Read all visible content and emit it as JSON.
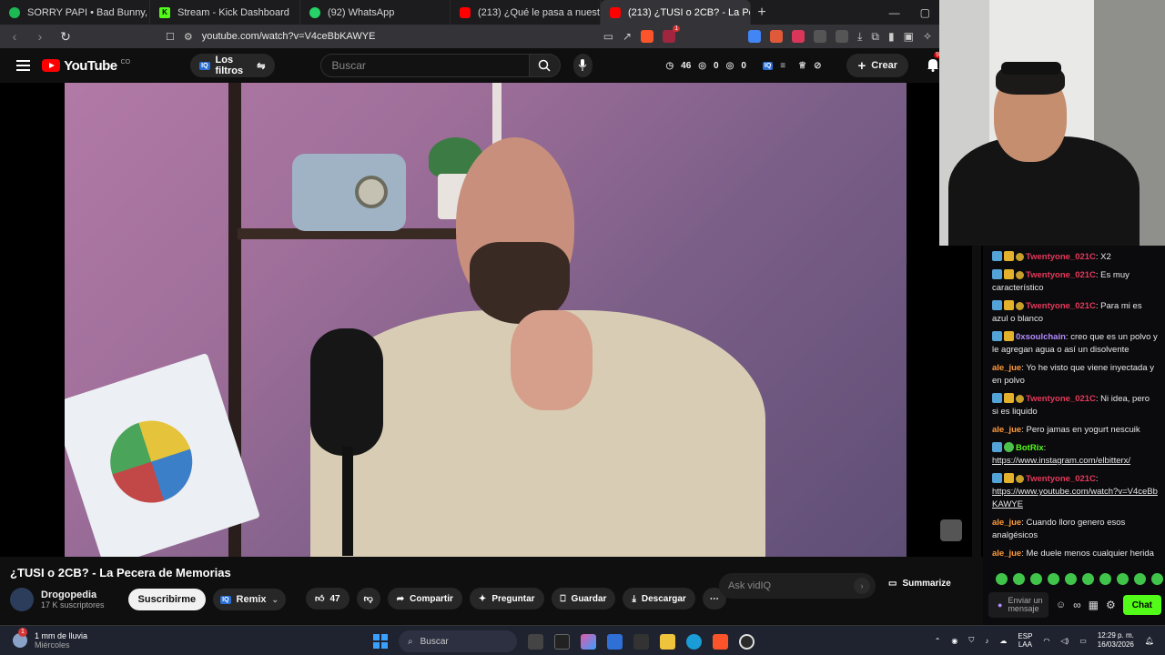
{
  "browser": {
    "tabs": [
      {
        "title": "SORRY PAPI • Bad Bunny, ABRA",
        "color": "#1db954",
        "active": false
      },
      {
        "title": "Stream - Kick Dashboard",
        "color": "#53fc18",
        "active": false
      },
      {
        "title": "(92) WhatsApp",
        "color": "#25d366",
        "active": false
      },
      {
        "title": "(213) ¿Qué le pasa a nuestro cuerpo",
        "color": "#ff0000",
        "active": false
      },
      {
        "title": "(213) ¿TUSI o 2CB? - La Pecera d",
        "color": "#ff0000",
        "active": true
      }
    ],
    "url": "youtube.com/watch?v=V4ceBbKAWYE",
    "shield_badge": "1"
  },
  "youtube": {
    "logo_text": "YouTube",
    "country_code": "CO",
    "filters_label": "Los filtros",
    "search_placeholder": "Buscar",
    "counts": {
      "a": "46",
      "b": "0",
      "c": "0"
    },
    "create_label": "Crear",
    "notif_badge": "9+"
  },
  "video": {
    "title": "¿TUSI o 2CB? - La Pecera de Memorias",
    "channel_name": "Drogopedia",
    "subscribers": "17 K suscriptores",
    "subscribe_label": "Suscribirme",
    "remix_label": "Remix",
    "likes": "47",
    "share_label": "Compartir",
    "ask_label": "Preguntar",
    "save_label": "Guardar",
    "download_label": "Descargar",
    "ask_placeholder": "Ask vidIQ",
    "summarize_label": "Summarize"
  },
  "chat": {
    "messages": [
      {
        "user": "Twentyone_021C",
        "color": "red",
        "badges": 3,
        "text": ": X2"
      },
      {
        "user": "Twentyone_021C",
        "color": "red",
        "badges": 3,
        "text": ": Es muy característico"
      },
      {
        "user": "Twentyone_021C",
        "color": "red",
        "badges": 3,
        "text": ": Para mi es azul o blanco"
      },
      {
        "user": "0xsoulchain",
        "color": "purple",
        "badges": 2,
        "text": ": creo que es un polvo y le agregan agua o así un disolvente"
      },
      {
        "user": "ale_jue",
        "color": "orange",
        "badges": 0,
        "text": ": Yo he visto que viene inyectada y en polvo"
      },
      {
        "user": "Twentyone_021C",
        "color": "red",
        "badges": 3,
        "text": ": Ni idea, pero si es liquido"
      },
      {
        "user": "ale_jue",
        "color": "orange",
        "badges": 0,
        "text": ": Pero jamas en yogurt nescuik"
      },
      {
        "user": "BotRix",
        "color": "green",
        "badges": 4,
        "text": ":",
        "link": "https://www.instagram.com/elbitterx/"
      },
      {
        "user": "Twentyone_021C",
        "color": "red",
        "badges": 3,
        "text": ":",
        "link": "https://www.youtube.com/watch?v=V4ceBbKAWYE"
      },
      {
        "user": "ale_jue",
        "color": "orange",
        "badges": 0,
        "text": ": Cuando lloro genero esos analgésicos"
      },
      {
        "user": "ale_jue",
        "color": "orange",
        "badges": 0,
        "text": ": Me duele menos cualquier herida"
      }
    ],
    "input_placeholder": "Enviar un mensaje",
    "send_label": "Chat"
  },
  "taskbar": {
    "weather_main": "1 mm de lluvia",
    "weather_sub": "Miércoles",
    "weather_badge": "1",
    "search_placeholder": "Buscar",
    "lang_top": "ESP",
    "lang_bottom": "LAA",
    "time": "12:29 p. m.",
    "date": "16/03/2026"
  }
}
